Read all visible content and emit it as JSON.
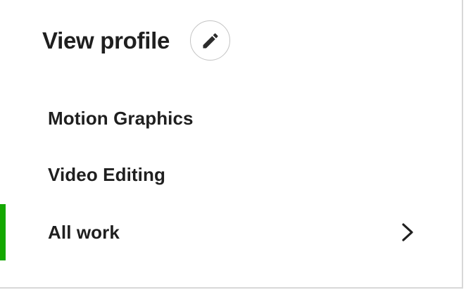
{
  "profile": {
    "title": "View profile"
  },
  "nav": {
    "items": [
      {
        "label": "Motion Graphics",
        "active": false
      },
      {
        "label": "Video Editing",
        "active": false
      },
      {
        "label": "All work",
        "active": true
      }
    ]
  },
  "icons": {
    "edit": "pencil-icon",
    "chevron": "chevron-right-icon"
  },
  "colors": {
    "active_indicator": "#14a800",
    "text": "#1f1f1f",
    "border": "#d8d8d8"
  }
}
